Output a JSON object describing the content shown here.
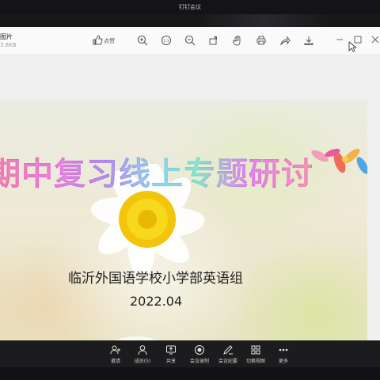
{
  "app": {
    "window_title": "钉钉会议"
  },
  "viewer": {
    "file_title": "图片",
    "file_size": "3.8KB",
    "like_label": "点赞",
    "toolbar_icons": [
      "thumbs-up-icon",
      "zoom-in-icon",
      "actual-size-icon",
      "zoom-out-icon",
      "rotate-icon",
      "hand-icon",
      "print-icon",
      "share-icon",
      "download-icon"
    ]
  },
  "slide": {
    "title": "期中复习线上专题研讨",
    "school": "临沂外国语学校小学部英语组",
    "date": "2022.04"
  },
  "meeting_bar": {
    "items": [
      {
        "label": "邀请",
        "icon": "invite-icon"
      },
      {
        "label": "成员(5)",
        "icon": "members-icon"
      },
      {
        "label": "共享",
        "icon": "share-screen-icon"
      },
      {
        "label": "会议录制",
        "icon": "record-icon"
      },
      {
        "label": "会议纪要",
        "icon": "notes-icon"
      },
      {
        "label": "切换视图",
        "icon": "view-icon"
      },
      {
        "label": "更多",
        "icon": "more-icon"
      }
    ]
  },
  "colors": {
    "accent": "#e8327a",
    "bar_bg": "#1c1c1e"
  }
}
